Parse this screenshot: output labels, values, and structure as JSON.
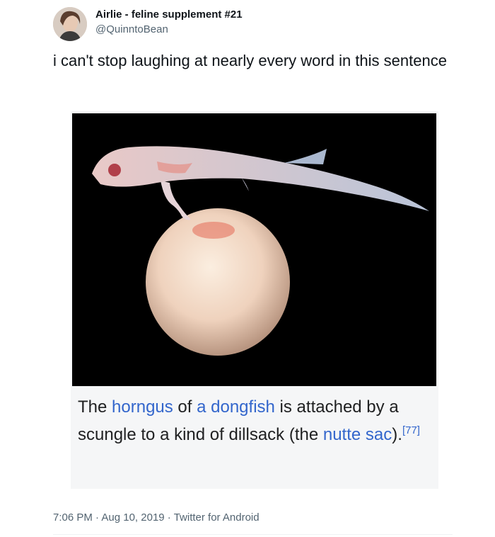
{
  "author": {
    "display_name": "Airlie - feline supplement #21",
    "handle": "@QuinntoBean"
  },
  "tweet": {
    "text": "i can't stop laughing at nearly every word in this sentence"
  },
  "media": {
    "caption_parts": [
      {
        "text": "The ",
        "link": false
      },
      {
        "text": "horngus",
        "link": true
      },
      {
        "text": " of ",
        "link": false
      },
      {
        "text": "a dongfish",
        "link": true
      },
      {
        "text": " is attached by a scungle to a kind of dillsack (the ",
        "link": false
      },
      {
        "text": "nutte sac",
        "link": true
      },
      {
        "text": ").",
        "link": false
      }
    ],
    "citation": "[77]"
  },
  "meta": {
    "time": "7:06 PM",
    "separator": " · ",
    "date": "Aug 10, 2019",
    "source": "Twitter for Android"
  },
  "colors": {
    "link": "#3366cc",
    "secondary_text": "#536471"
  }
}
